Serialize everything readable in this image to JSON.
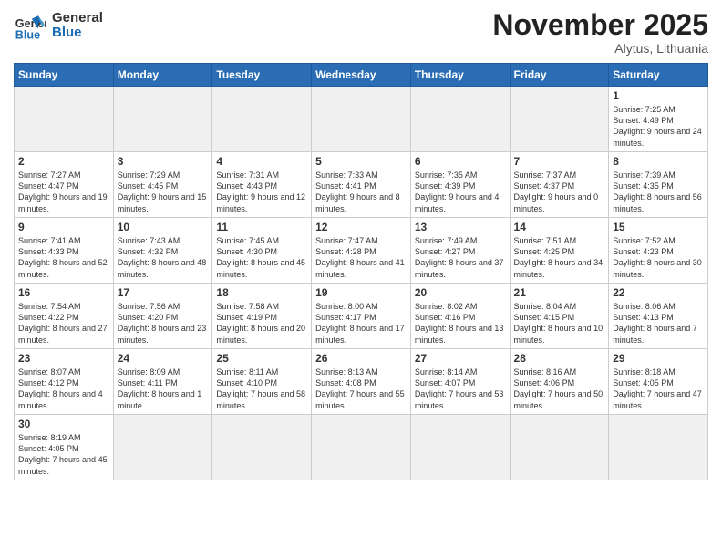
{
  "header": {
    "logo_general": "General",
    "logo_blue": "Blue",
    "month_title": "November 2025",
    "location": "Alytus, Lithuania"
  },
  "weekdays": [
    "Sunday",
    "Monday",
    "Tuesday",
    "Wednesday",
    "Thursday",
    "Friday",
    "Saturday"
  ],
  "days": {
    "d1": {
      "num": "1",
      "sunrise": "7:25 AM",
      "sunset": "4:49 PM",
      "daylight": "9 hours and 24 minutes."
    },
    "d2": {
      "num": "2",
      "sunrise": "7:27 AM",
      "sunset": "4:47 PM",
      "daylight": "9 hours and 19 minutes."
    },
    "d3": {
      "num": "3",
      "sunrise": "7:29 AM",
      "sunset": "4:45 PM",
      "daylight": "9 hours and 15 minutes."
    },
    "d4": {
      "num": "4",
      "sunrise": "7:31 AM",
      "sunset": "4:43 PM",
      "daylight": "9 hours and 12 minutes."
    },
    "d5": {
      "num": "5",
      "sunrise": "7:33 AM",
      "sunset": "4:41 PM",
      "daylight": "9 hours and 8 minutes."
    },
    "d6": {
      "num": "6",
      "sunrise": "7:35 AM",
      "sunset": "4:39 PM",
      "daylight": "9 hours and 4 minutes."
    },
    "d7": {
      "num": "7",
      "sunrise": "7:37 AM",
      "sunset": "4:37 PM",
      "daylight": "9 hours and 0 minutes."
    },
    "d8": {
      "num": "8",
      "sunrise": "7:39 AM",
      "sunset": "4:35 PM",
      "daylight": "8 hours and 56 minutes."
    },
    "d9": {
      "num": "9",
      "sunrise": "7:41 AM",
      "sunset": "4:33 PM",
      "daylight": "8 hours and 52 minutes."
    },
    "d10": {
      "num": "10",
      "sunrise": "7:43 AM",
      "sunset": "4:32 PM",
      "daylight": "8 hours and 48 minutes."
    },
    "d11": {
      "num": "11",
      "sunrise": "7:45 AM",
      "sunset": "4:30 PM",
      "daylight": "8 hours and 45 minutes."
    },
    "d12": {
      "num": "12",
      "sunrise": "7:47 AM",
      "sunset": "4:28 PM",
      "daylight": "8 hours and 41 minutes."
    },
    "d13": {
      "num": "13",
      "sunrise": "7:49 AM",
      "sunset": "4:27 PM",
      "daylight": "8 hours and 37 minutes."
    },
    "d14": {
      "num": "14",
      "sunrise": "7:51 AM",
      "sunset": "4:25 PM",
      "daylight": "8 hours and 34 minutes."
    },
    "d15": {
      "num": "15",
      "sunrise": "7:52 AM",
      "sunset": "4:23 PM",
      "daylight": "8 hours and 30 minutes."
    },
    "d16": {
      "num": "16",
      "sunrise": "7:54 AM",
      "sunset": "4:22 PM",
      "daylight": "8 hours and 27 minutes."
    },
    "d17": {
      "num": "17",
      "sunrise": "7:56 AM",
      "sunset": "4:20 PM",
      "daylight": "8 hours and 23 minutes."
    },
    "d18": {
      "num": "18",
      "sunrise": "7:58 AM",
      "sunset": "4:19 PM",
      "daylight": "8 hours and 20 minutes."
    },
    "d19": {
      "num": "19",
      "sunrise": "8:00 AM",
      "sunset": "4:17 PM",
      "daylight": "8 hours and 17 minutes."
    },
    "d20": {
      "num": "20",
      "sunrise": "8:02 AM",
      "sunset": "4:16 PM",
      "daylight": "8 hours and 13 minutes."
    },
    "d21": {
      "num": "21",
      "sunrise": "8:04 AM",
      "sunset": "4:15 PM",
      "daylight": "8 hours and 10 minutes."
    },
    "d22": {
      "num": "22",
      "sunrise": "8:06 AM",
      "sunset": "4:13 PM",
      "daylight": "8 hours and 7 minutes."
    },
    "d23": {
      "num": "23",
      "sunrise": "8:07 AM",
      "sunset": "4:12 PM",
      "daylight": "8 hours and 4 minutes."
    },
    "d24": {
      "num": "24",
      "sunrise": "8:09 AM",
      "sunset": "4:11 PM",
      "daylight": "8 hours and 1 minute."
    },
    "d25": {
      "num": "25",
      "sunrise": "8:11 AM",
      "sunset": "4:10 PM",
      "daylight": "7 hours and 58 minutes."
    },
    "d26": {
      "num": "26",
      "sunrise": "8:13 AM",
      "sunset": "4:08 PM",
      "daylight": "7 hours and 55 minutes."
    },
    "d27": {
      "num": "27",
      "sunrise": "8:14 AM",
      "sunset": "4:07 PM",
      "daylight": "7 hours and 53 minutes."
    },
    "d28": {
      "num": "28",
      "sunrise": "8:16 AM",
      "sunset": "4:06 PM",
      "daylight": "7 hours and 50 minutes."
    },
    "d29": {
      "num": "29",
      "sunrise": "8:18 AM",
      "sunset": "4:05 PM",
      "daylight": "7 hours and 47 minutes."
    },
    "d30": {
      "num": "30",
      "sunrise": "8:19 AM",
      "sunset": "4:05 PM",
      "daylight": "7 hours and 45 minutes."
    }
  }
}
